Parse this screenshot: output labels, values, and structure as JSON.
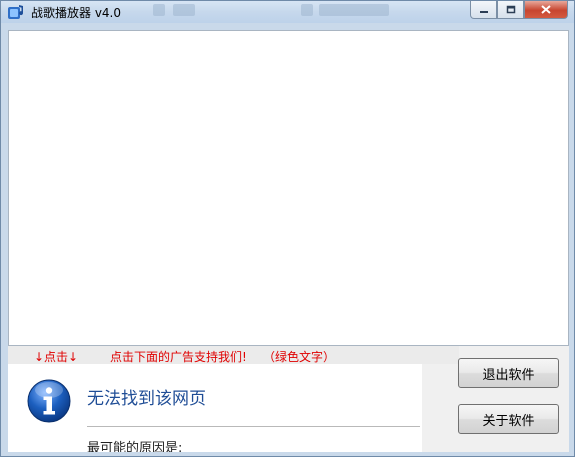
{
  "window": {
    "title": "战歌播放器 v4.0",
    "controls": {
      "minimize": "▭",
      "maximize": "◻",
      "close": "✕"
    }
  },
  "ad_strip": {
    "arrows_hint": "↓点击↓",
    "support_text": "点击下面的广告支持我们!",
    "green_note": "（绿色文字）"
  },
  "error_page": {
    "title": "无法找到该网页",
    "reason_intro": "最可能的原因是:"
  },
  "buttons": {
    "exit": "退出软件",
    "about": "关于软件"
  },
  "icons": {
    "app": "music-player-icon",
    "info": "info-icon"
  },
  "colors": {
    "ad_text": "#e00000",
    "error_title": "#1f4d96",
    "info_icon": "#1c5fbf"
  }
}
